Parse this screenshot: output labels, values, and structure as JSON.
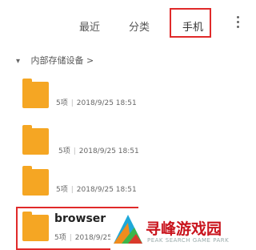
{
  "tabs": {
    "recent": "最近",
    "category": "分类",
    "phone": "手机"
  },
  "breadcrumb": {
    "label": "内部存储设备",
    "arrow": ">"
  },
  "folders": [
    {
      "name": "",
      "count": "5项",
      "date": "2018/9/25 18:51"
    },
    {
      "name": "",
      "count": "5项",
      "date": "2018/9/25 18:51"
    },
    {
      "name": "",
      "count": "5项",
      "date": "2018/9/25 18:51"
    },
    {
      "name": "browser",
      "count": "5项",
      "date": "2018/9/25 18:51"
    }
  ],
  "watermark": {
    "title": "寻峰游戏园",
    "subtitle": "PEAK SEARCH GAME PARK"
  },
  "colors": {
    "accent_red": "#e02a2a",
    "folder_orange": "#f5a623"
  }
}
